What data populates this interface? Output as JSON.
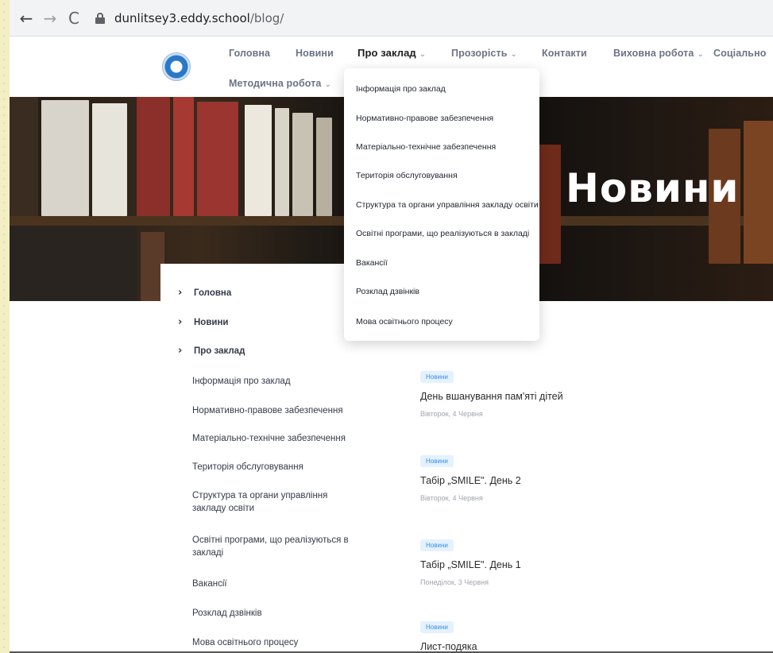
{
  "browser": {
    "url_host": "dunlitsey3.eddy.school",
    "url_path": "/blog/",
    "back_icon": "←",
    "forward_icon": "→",
    "reload_icon": "C"
  },
  "header": {
    "menu": [
      {
        "label": "Головна"
      },
      {
        "label": "Новини"
      },
      {
        "label": "Про заклад",
        "has_chevron": true,
        "active": true
      },
      {
        "label": "Прозорість",
        "has_chevron": true
      },
      {
        "label": "Контакти"
      },
      {
        "label": "Виховна робота",
        "has_chevron": true
      },
      {
        "label": "Соціально"
      },
      {
        "label": "Методична робота",
        "has_chevron": true
      }
    ],
    "chevron": "⌄"
  },
  "hero": {
    "title": "Новини"
  },
  "dropdown": {
    "items": [
      "Інформація про заклад",
      "Нормативно-правове забезпечення",
      "Матеріально-технічне забезпечення",
      "Територія обслуговування",
      "Структура та органи управління закладу освіти",
      "Освітні програми, що реалізуються в закладі",
      "Вакансії",
      "Розклад дзвінків",
      "Мова освітнього процесу"
    ]
  },
  "sidebar": {
    "chevron": "›",
    "top_items": [
      "Головна",
      "Новини",
      "Про заклад"
    ],
    "sub_items": [
      "Інформація про заклад",
      "Нормативно-правове забезпечення",
      "Матеріально-технічне забезпечення",
      "Територія обслуговування",
      "Структура та органи управління закладу освіти",
      "Освітні програми, що реалізуються в закладі",
      "Вакансії",
      "Розклад дзвінків",
      "Мова освітнього процесу"
    ]
  },
  "news": {
    "items": [
      {
        "badge": "Новини",
        "title": "День вшанування пам'яті дітей",
        "date": "Вівторок, 4 Червня"
      },
      {
        "badge": "Новини",
        "title": "Табір „SMILE\". День 2",
        "date": "Вівторок, 4 Червня"
      },
      {
        "badge": "Новини",
        "title": "Табір „SMILE\". День 1",
        "date": "Понеділок, 3 Червня"
      },
      {
        "badge": "Новини",
        "title": "Лист-подяка",
        "date": ""
      }
    ]
  }
}
